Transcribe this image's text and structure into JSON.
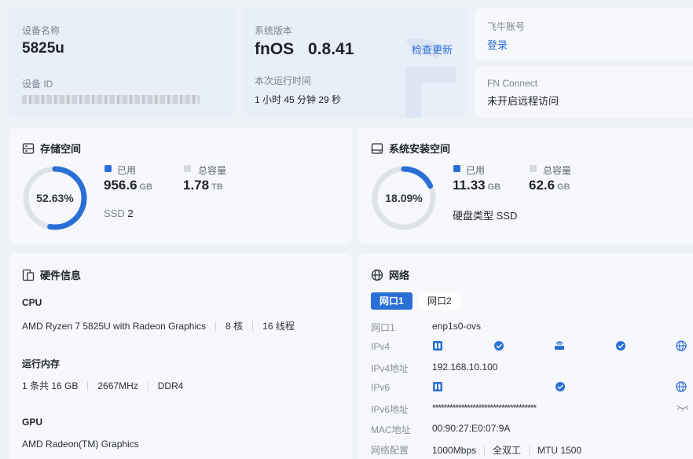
{
  "device": {
    "name_label": "设备名称",
    "name": "5825u",
    "id_label": "设备 ID"
  },
  "system": {
    "version_label": "系统版本",
    "os": "fnOS",
    "version": "0.8.41",
    "check_update": "检查更新",
    "uptime_label": "本次运行时间",
    "uptime": "1 小时 45 分钟 29 秒"
  },
  "account": {
    "label": "飞牛账号",
    "login": "登录"
  },
  "connect": {
    "label": "FN Connect",
    "status": "未开启远程访问"
  },
  "storage": {
    "title": "存储空间",
    "percent_text": "52.63%",
    "percent": 52.63,
    "used_label": "已用",
    "used_value": "956.6",
    "used_unit": "GB",
    "total_label": "总容量",
    "total_value": "1.78",
    "total_unit": "TB",
    "ssd_label": "SSD",
    "ssd_count": "2"
  },
  "sys_storage": {
    "title": "系统安装空间",
    "percent_text": "18.09%",
    "percent": 18.09,
    "used_label": "已用",
    "used_value": "11.33",
    "used_unit": "GB",
    "total_label": "总容量",
    "total_value": "62.6",
    "total_unit": "GB",
    "disk_type_label": "硬盘类型",
    "disk_type": "SSD"
  },
  "hardware": {
    "title": "硬件信息",
    "cpu_label": "CPU",
    "cpu_model": "AMD Ryzen 7 5825U with Radeon Graphics",
    "cpu_cores": "8 核",
    "cpu_threads": "16 线程",
    "ram_label": "运行内存",
    "ram_size": "1 条共 16 GB",
    "ram_speed": "2667MHz",
    "ram_type": "DDR4",
    "gpu_label": "GPU",
    "gpu_model": "AMD Radeon(TM) Graphics"
  },
  "network": {
    "title": "网络",
    "tabs": [
      "网口1",
      "网口2"
    ],
    "port_label": "网口1",
    "port_value": "enp1s0-ovs",
    "ipv4_label": "IPv4",
    "ipv4_addr_label": "IPv4地址",
    "ipv4_addr": "192.168.10.100",
    "ipv6_label": "IPv6",
    "ipv6_addr_label": "IPv6地址",
    "ipv6_addr": "************************************",
    "mac_label": "MAC地址",
    "mac": "00:90:27:E0:07:9A",
    "config_label": "网络配置",
    "speed": "1000Mbps",
    "duplex": "全双工",
    "mtu": "MTU 1500"
  },
  "colors": {
    "accent": "#2a6fd6",
    "track": "#dfe2e8",
    "total": "#d6d9df"
  }
}
